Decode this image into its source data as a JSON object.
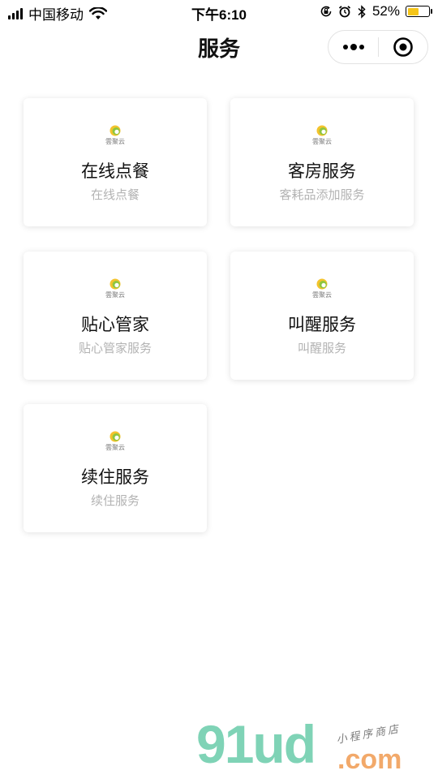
{
  "status_bar": {
    "carrier": "中国移动",
    "time": "下午6:10",
    "battery_percent": "52%",
    "battery_level": 0.52,
    "battery_color": "#f5c518",
    "icons": [
      "signal-icon",
      "wifi-icon",
      "orientation-lock-icon",
      "alarm-icon",
      "bluetooth-icon",
      "battery-icon"
    ]
  },
  "nav": {
    "title": "服务",
    "more_icon": "more-dots-icon",
    "close_icon": "target-close-icon"
  },
  "logo": {
    "text": "雲聚云",
    "colors": [
      "#f3c32c",
      "#8ec63f",
      "#5aa03a"
    ]
  },
  "services": [
    {
      "title": "在线点餐",
      "subtitle": "在线点餐"
    },
    {
      "title": "客房服务",
      "subtitle": "客耗品添加服务"
    },
    {
      "title": "贴心管家",
      "subtitle": "贴心管家服务"
    },
    {
      "title": "叫醒服务",
      "subtitle": "叫醒服务"
    },
    {
      "title": "续住服务",
      "subtitle": "续住服务"
    }
  ],
  "watermark": {
    "brand": "91ud",
    "domain": ".com",
    "tagline": "小程序商店"
  }
}
